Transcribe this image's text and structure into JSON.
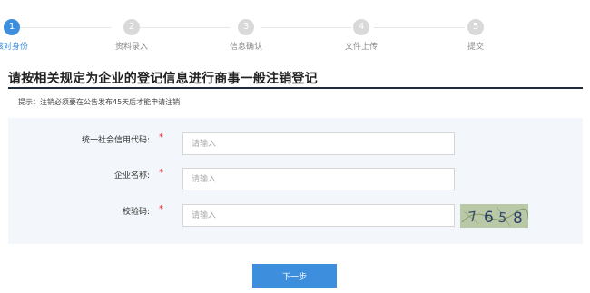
{
  "steps": [
    {
      "num": "1",
      "label": "核对身份"
    },
    {
      "num": "2",
      "label": "资料录入"
    },
    {
      "num": "3",
      "label": "信息确认"
    },
    {
      "num": "4",
      "label": "文件上传"
    },
    {
      "num": "5",
      "label": "提交"
    }
  ],
  "active_step": 1,
  "page_title": "请按相关规定为企业的登记信息进行商事一般注销登记",
  "notice": "提示：注销必须要在公告发布45天后才能申请注销",
  "form": {
    "credit_code": {
      "label": "统一社会信用代码:",
      "required": "*",
      "placeholder": "请输入",
      "value": ""
    },
    "company_name": {
      "label": "企业名称:",
      "required": "*",
      "placeholder": "请输入",
      "value": ""
    },
    "captcha": {
      "label": "校验码:",
      "required": "*",
      "placeholder": "请输入",
      "value": "",
      "image_text": "7658"
    }
  },
  "next_button": "下一步",
  "colors": {
    "accent": "#3d8fde",
    "required": "#e02020",
    "panel_bg": "#f3f6fa"
  }
}
